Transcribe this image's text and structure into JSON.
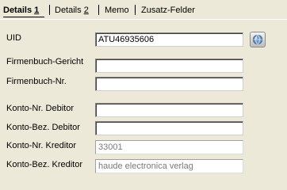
{
  "tabs": [
    {
      "label": "Details ",
      "key": "1",
      "active": true
    },
    {
      "label": "Details ",
      "key": "2",
      "active": false
    },
    {
      "label": "Memo",
      "key": "",
      "active": false
    },
    {
      "label": "Zusatz-Felder",
      "key": "",
      "active": false
    }
  ],
  "form": {
    "uid": {
      "label": "UID",
      "value": "ATU46935606"
    },
    "firmenbuch_gericht": {
      "label": "Firmenbuch-Gericht",
      "value": ""
    },
    "firmenbuch_nr": {
      "label": "Firmenbuch-Nr.",
      "value": ""
    },
    "konto_nr_debitor": {
      "label": "Konto-Nr. Debitor",
      "value": ""
    },
    "konto_bez_debitor": {
      "label": "Konto-Bez. Debitor",
      "value": ""
    },
    "konto_nr_kreditor": {
      "label": "Konto-Nr. Kreditor",
      "value": "33001"
    },
    "konto_bez_kreditor": {
      "label": "Konto-Bez. Kreditor",
      "value": "haude electronica verlag"
    }
  },
  "icons": {
    "uid_lookup": "globe-lookup-icon"
  },
  "colors": {
    "background": "#ece9d8",
    "readonly_text": "#7a7a7a"
  }
}
